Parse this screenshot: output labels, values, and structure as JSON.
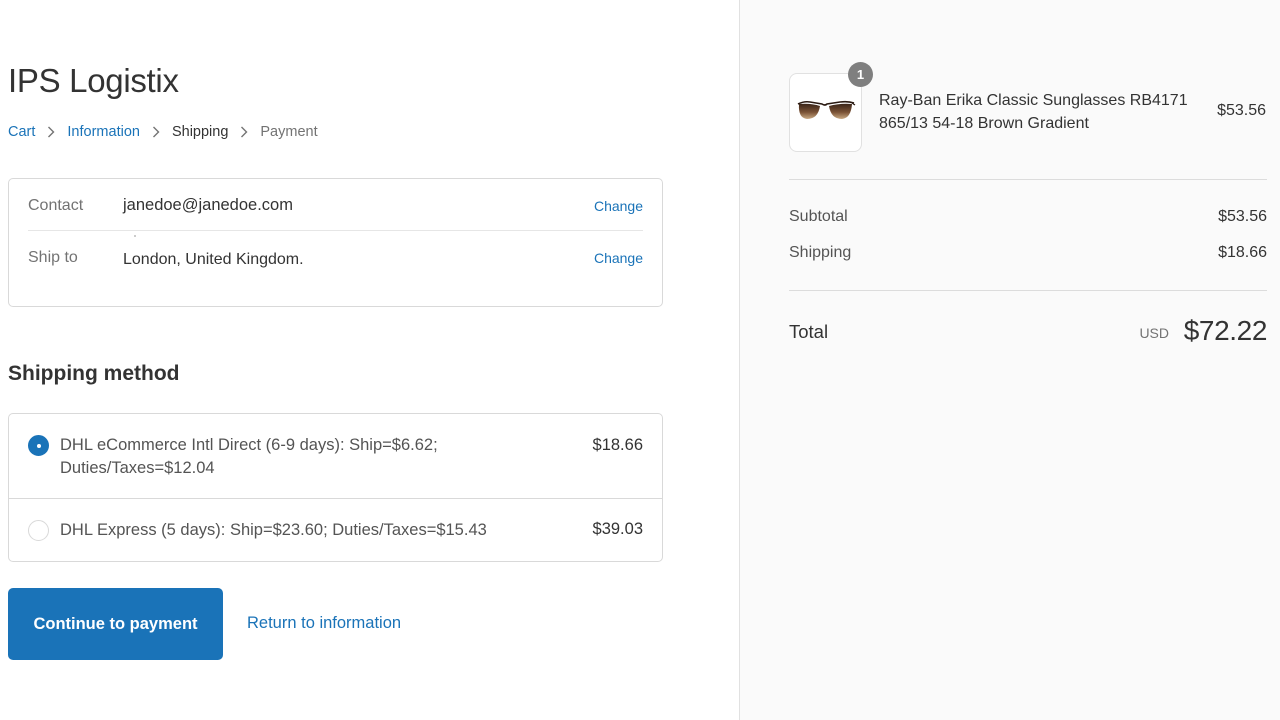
{
  "shop": {
    "title": "IPS Logistix"
  },
  "breadcrumb": {
    "items": [
      {
        "label": "Cart"
      },
      {
        "label": "Information"
      },
      {
        "label": "Shipping"
      },
      {
        "label": "Payment"
      }
    ],
    "separator_icon": "chevron-right-icon"
  },
  "review": {
    "contact": {
      "label": "Contact",
      "value": "janedoe@janedoe.com",
      "change_label": "Change"
    },
    "ship_to": {
      "label": "Ship to",
      "value": "London, United Kingdom.",
      "change_label": "Change"
    }
  },
  "shipping_method": {
    "title": "Shipping method",
    "options": [
      {
        "label": "DHL eCommerce Intl Direct (6-9 days): Ship=$6.62; Duties/Taxes=$12.04",
        "price": "$18.66",
        "selected": true
      },
      {
        "label": "DHL Express (5 days): Ship=$23.60; Duties/Taxes=$15.43",
        "price": "$39.03",
        "selected": false
      }
    ]
  },
  "actions": {
    "continue_label": "Continue to payment",
    "return_label": "Return to information"
  },
  "order_summary": {
    "product": {
      "name": "Ray-Ban Erika Classic Sunglasses RB4171 865/13 54-18 Brown Gradient",
      "price": "$53.56",
      "quantity": "1",
      "image_icon": "sunglasses-icon"
    },
    "subtotal": {
      "label": "Subtotal",
      "value": "$53.56"
    },
    "shipping": {
      "label": "Shipping",
      "value": "$18.66"
    },
    "total": {
      "label": "Total",
      "currency": "USD",
      "value": "$72.22"
    }
  },
  "colors": {
    "accent": "#1a73b8",
    "sidebar_bg": "#fafafa",
    "border": "#d9d9d9",
    "text": "#333333",
    "muted_text": "#737373"
  }
}
